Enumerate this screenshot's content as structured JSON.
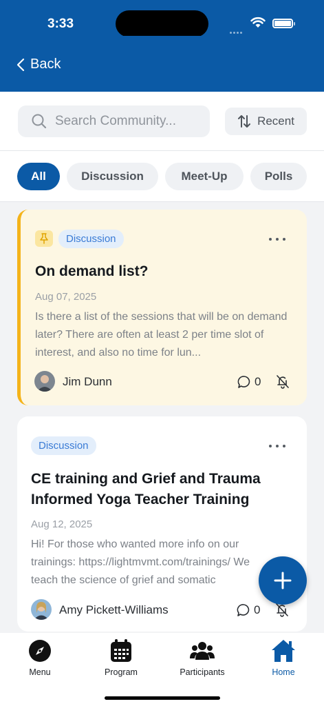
{
  "status_bar": {
    "time": "3:33"
  },
  "nav": {
    "back_label": "Back"
  },
  "search": {
    "placeholder": "Search Community...",
    "value": ""
  },
  "sort": {
    "label": "Recent"
  },
  "filters": [
    {
      "label": "All",
      "active": true
    },
    {
      "label": "Discussion",
      "active": false
    },
    {
      "label": "Meet-Up",
      "active": false
    },
    {
      "label": "Polls",
      "active": false
    }
  ],
  "posts": [
    {
      "pinned": true,
      "tag": "Discussion",
      "title": "On demand list?",
      "date": "Aug 07, 2025",
      "body": "Is there a list of the sessions that will be on demand later? There are often at least 2 per time slot of interest, and also no time for lun...",
      "author": "Jim Dunn",
      "comments": "0"
    },
    {
      "pinned": false,
      "tag": "Discussion",
      "title": "CE  training and Grief and Trauma Informed Yoga Teacher Training",
      "date": "Aug 12, 2025",
      "body": "Hi! For those who wanted more info on our trainings: https://lightmvmt.com/trainings/ We teach the science of grief and somatic",
      "author": "Amy Pickett-Williams",
      "comments": "0"
    }
  ],
  "tabs": [
    {
      "label": "Menu",
      "icon": "compass-icon"
    },
    {
      "label": "Program",
      "icon": "calendar-icon"
    },
    {
      "label": "Participants",
      "icon": "users-icon"
    },
    {
      "label": "Home",
      "icon": "home-icon",
      "active": true
    }
  ],
  "colors": {
    "brand": "#0b5aa6",
    "pinned_bg": "#fdf7e3",
    "pinned_accent": "#f4b31a",
    "tag_bg": "#e3eefb",
    "tag_text": "#3a7bd5"
  }
}
